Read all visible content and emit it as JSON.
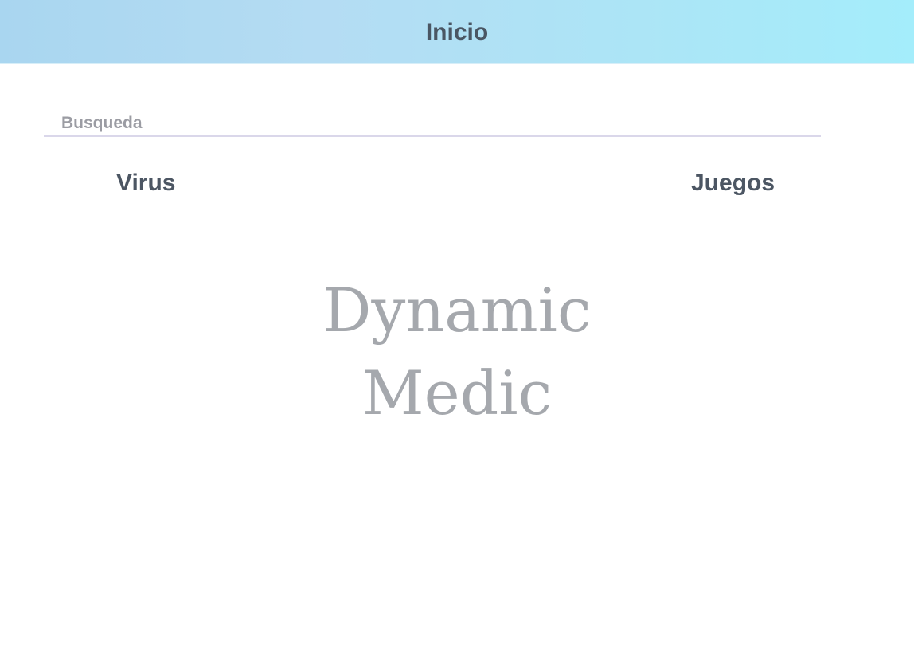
{
  "header": {
    "title": "Inicio"
  },
  "search": {
    "placeholder": "Busqueda"
  },
  "nav": {
    "virus_label": "Virus",
    "juegos_label": "Juegos"
  },
  "brand": {
    "line1": "Dynamic",
    "line2": "Medic",
    "color": "#a5a8ad"
  },
  "colors": {
    "header_gradient_start": "#a9d6f0",
    "header_gradient_end": "#a4edfb",
    "heading_text": "#4c5663",
    "search_underline": "#dad7ea"
  }
}
